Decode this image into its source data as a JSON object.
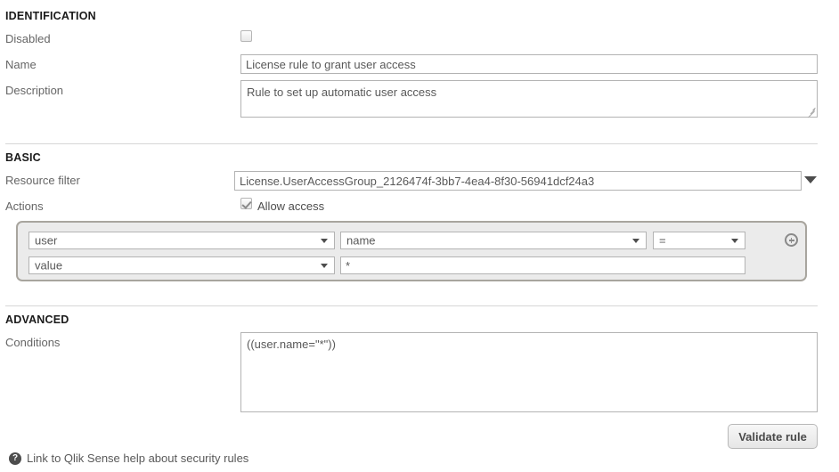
{
  "sections": {
    "identification": {
      "title": "IDENTIFICATION",
      "disabled_label": "Disabled",
      "disabled_checked": false,
      "name_label": "Name",
      "name_value": "License rule to grant user access",
      "description_label": "Description",
      "description_value": "Rule to set up automatic user access"
    },
    "basic": {
      "title": "BASIC",
      "resource_filter_label": "Resource filter",
      "resource_filter_value": "License.UserAccessGroup_2126474f-3bb7-4ea4-8f30-56941dcf24a3",
      "actions_label": "Actions",
      "allow_access_label": "Allow access",
      "allow_access_checked": true,
      "condition_builder": {
        "subject_value": "user",
        "property_value": "name",
        "operator_value": "=",
        "value_type_value": "value",
        "value_text": "*",
        "add_icon": "plus-circle-icon"
      }
    },
    "advanced": {
      "title": "ADVANCED",
      "conditions_label": "Conditions",
      "conditions_value": "((user.name=\"*\"))"
    }
  },
  "footer": {
    "validate_button_label": "Validate rule",
    "help_icon": "question-circle-icon",
    "help_link_text": "Link to Qlik Sense help about security rules"
  },
  "colors": {
    "input_border": "#b3b3b3",
    "panel_background": "#ebebeb",
    "panel_border": "#a8a59e",
    "divider": "#d6d6d6",
    "label_text": "#666666",
    "heading_text": "#1a1a1a"
  }
}
